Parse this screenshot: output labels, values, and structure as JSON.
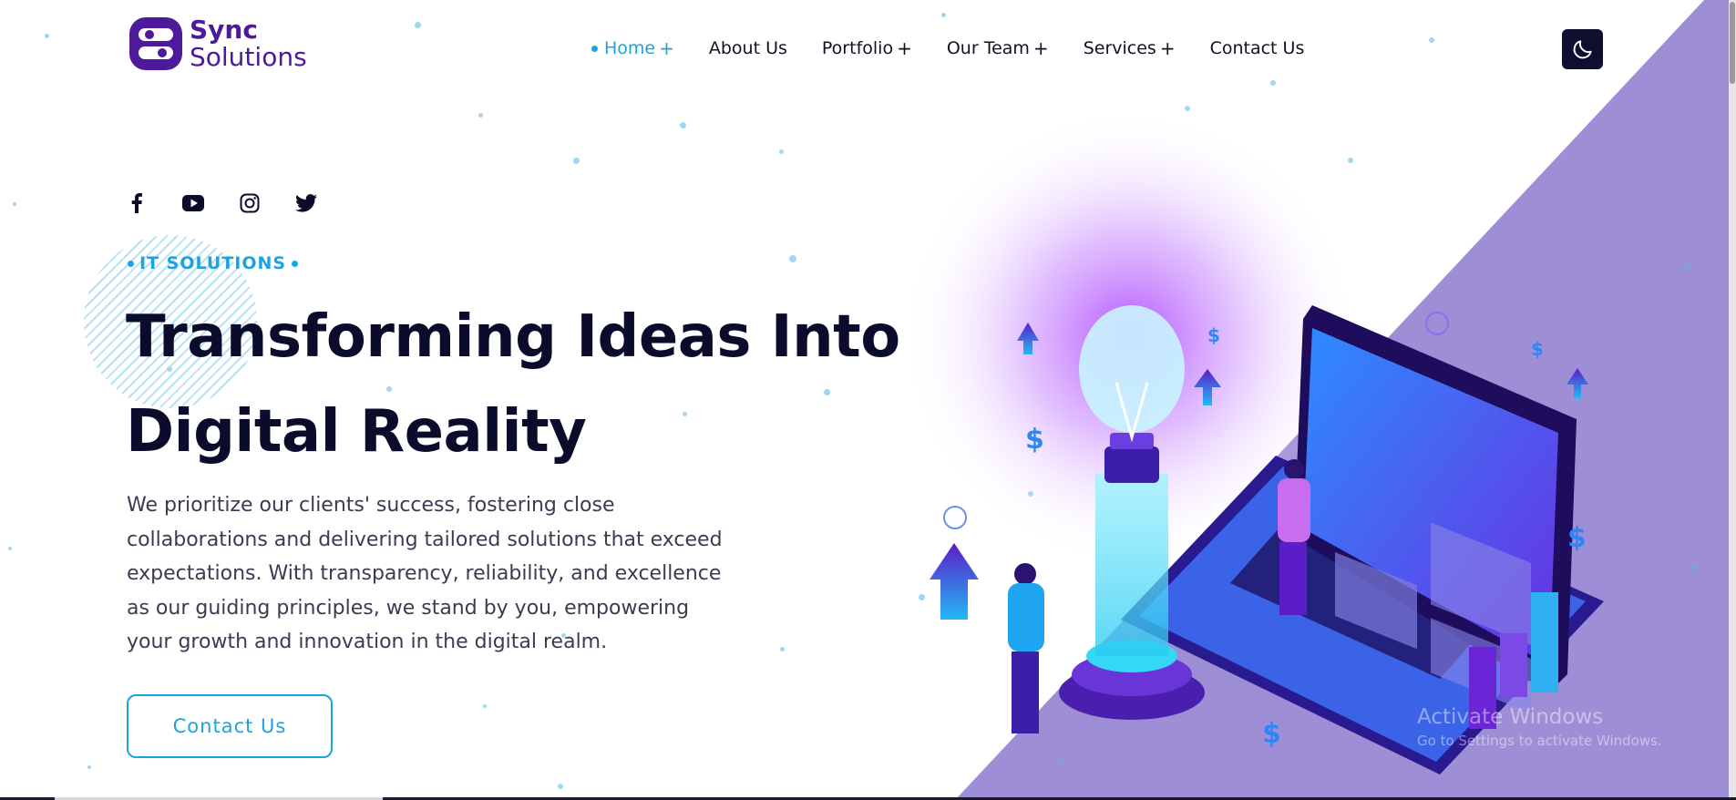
{
  "brand": {
    "line1": "Sync",
    "line2": "Solutions",
    "color": "#4c1a9a"
  },
  "nav": {
    "items": [
      {
        "label": "Home",
        "active": true,
        "has_submenu": true
      },
      {
        "label": "About Us",
        "active": false,
        "has_submenu": false
      },
      {
        "label": "Portfolio",
        "active": false,
        "has_submenu": true
      },
      {
        "label": "Our Team",
        "active": false,
        "has_submenu": true
      },
      {
        "label": "Services",
        "active": false,
        "has_submenu": true
      },
      {
        "label": "Contact Us",
        "active": false,
        "has_submenu": false
      }
    ],
    "plus": "+",
    "accent": "#1aa4e0"
  },
  "theme_toggle": {
    "icon": "moon-icon"
  },
  "social": [
    "facebook-icon",
    "youtube-icon",
    "instagram-icon",
    "twitter-icon"
  ],
  "hero": {
    "eyebrow": "IT SOLUTIONS",
    "headline_line1": "Transforming Ideas Into",
    "headline_line2": "Digital Reality",
    "paragraph": "We prioritize our clients' success, fostering close collaborations and delivering tailored solutions that exceed expectations. With transparency, reliability, and excellence as our guiding principles, we stand by you, empowering your growth and innovation in the digital realm.",
    "cta_label": "Contact Us"
  },
  "watermark": {
    "title": "Activate Windows",
    "subtitle": "Go to Settings to activate Windows."
  },
  "colors": {
    "purple_panel": "#9e8ed6",
    "dark": "#0b0b2b",
    "accent": "#1aa4e0"
  }
}
